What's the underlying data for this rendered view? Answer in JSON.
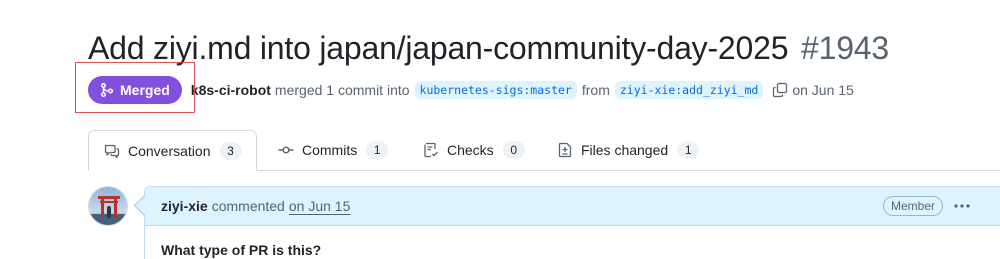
{
  "pr": {
    "title": "Add ziyi.md into japan/japan-community-day-2025",
    "number": "#1943",
    "state_label": "Merged",
    "author": "k8s-ci-robot",
    "merged_text": "merged 1 commit into",
    "base_branch": "kubernetes-sigs:master",
    "from_text": "from",
    "head_branch": "ziyi-xie:add_ziyi_md",
    "date_text": "on Jun 15"
  },
  "tabs": [
    {
      "label": "Conversation",
      "count": "3",
      "icon": "comment-discussion-icon"
    },
    {
      "label": "Commits",
      "count": "1",
      "icon": "git-commit-icon"
    },
    {
      "label": "Checks",
      "count": "0",
      "icon": "checklist-icon"
    },
    {
      "label": "Files changed",
      "count": "1",
      "icon": "file-diff-icon"
    }
  ],
  "comment": {
    "author": "ziyi-xie",
    "action": "commented",
    "date": "on Jun 15",
    "role_badge": "Member",
    "body_heading": "What type of PR is this?"
  },
  "colors": {
    "merged": "#8250df",
    "link": "#0969da",
    "branch_bg": "#ddf4ff",
    "comment_header_bg": "#ddf4ff",
    "highlight": "#d9534f"
  },
  "icons": {
    "merge": "git-merge-icon",
    "copy": "copy-icon",
    "kebab": "kebab-horizontal-icon"
  }
}
